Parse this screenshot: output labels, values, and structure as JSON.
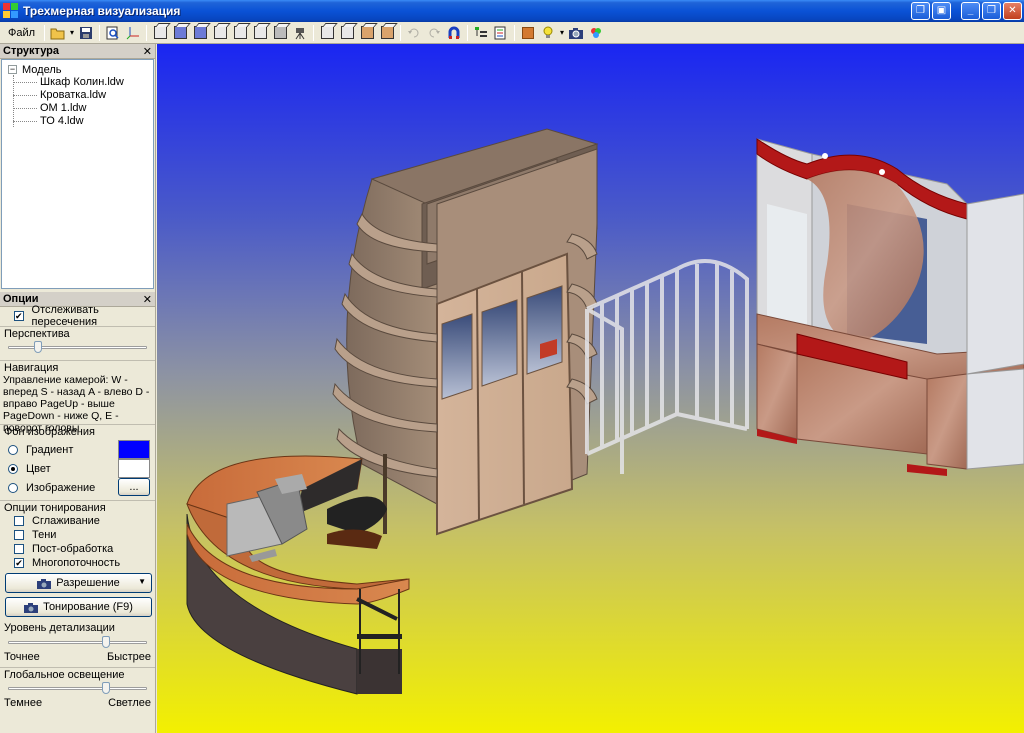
{
  "window": {
    "title": "Трехмерная визуализация"
  },
  "toolbar": {
    "file_label": "Файл"
  },
  "structure": {
    "title": "Структура",
    "root": "Модель",
    "root_toggle": "−",
    "items": [
      "Шкаф Колин.ldw",
      "Кроватка.ldw",
      "ОМ 1.ldw",
      "ТО 4.ldw"
    ]
  },
  "options": {
    "title": "Опции",
    "track_intersections": {
      "label": "Отслеживать пересечения",
      "checked": true
    },
    "perspective_label": "Перспектива",
    "perspective_value": 0.2,
    "navigation_label": "Навигация",
    "navigation_text": "Управление камерой: W - вперед S - назад A - влево D - вправо PageUp - выше PageDown - ниже Q, E - поворот головы",
    "background": {
      "label": "Фон изображения",
      "gradient_label": "Градиент",
      "color_label": "Цвет",
      "image_label": "Изображение",
      "selected": "Цвет",
      "gradient_color_top": "#0000ff",
      "gradient_color_bottom": "#ffffff",
      "browse_label": "..."
    },
    "render_options": {
      "label": "Опции тонирования",
      "antialiasing": {
        "label": "Сглаживание",
        "checked": false
      },
      "shadows": {
        "label": "Тени",
        "checked": false
      },
      "postprocessing": {
        "label": "Пост-обработка",
        "checked": false
      },
      "multithreading": {
        "label": "Многопоточность",
        "checked": true
      }
    },
    "resolution_button": "Разрешение",
    "render_button": "Тонирование (F9)",
    "detail": {
      "label": "Уровень детализации",
      "value": 0.72,
      "min_label": "Точнее",
      "max_label": "Быстрее"
    },
    "lighting": {
      "label": "Глобальное освещение",
      "value": 0.72,
      "min_label": "Темнее",
      "max_label": "Светлее"
    }
  },
  "viewport": {
    "background_top": "#1a26f2",
    "background_bottom": "#f3f000"
  }
}
